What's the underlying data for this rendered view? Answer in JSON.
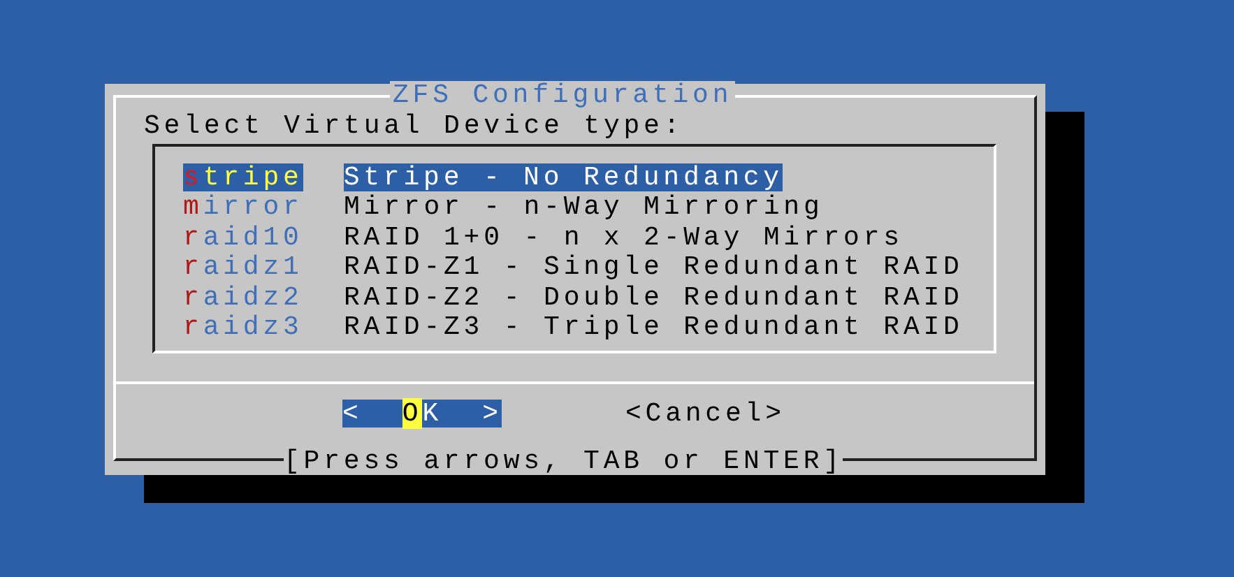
{
  "dialog": {
    "title": "ZFS Configuration",
    "prompt": "Select Virtual Device type:",
    "items": [
      {
        "tag_hotkey": "s",
        "tag_rest": "tripe",
        "description": "Stripe - No Redundancy",
        "selected": true
      },
      {
        "tag_hotkey": "m",
        "tag_rest": "irror",
        "description": "Mirror - n-Way Mirroring",
        "selected": false
      },
      {
        "tag_hotkey": "r",
        "tag_rest": "aid10",
        "description": "RAID 1+0 - n x 2-Way Mirrors",
        "selected": false
      },
      {
        "tag_hotkey": "r",
        "tag_rest": "aidz1",
        "description": "RAID-Z1 - Single Redundant RAID",
        "selected": false
      },
      {
        "tag_hotkey": "r",
        "tag_rest": "aidz2",
        "description": "RAID-Z2 - Double Redundant RAID",
        "selected": false
      },
      {
        "tag_hotkey": "r",
        "tag_rest": "aidz3",
        "description": "RAID-Z3 - Triple Redundant RAID",
        "selected": false
      }
    ],
    "buttons": [
      {
        "prefix": "<  ",
        "hotkey": "O",
        "rest": "K  >",
        "selected": true
      },
      {
        "prefix": "<",
        "hotkey": "C",
        "rest": "ancel>",
        "selected": false
      }
    ],
    "hint": "[Press arrows, TAB or ENTER]"
  }
}
